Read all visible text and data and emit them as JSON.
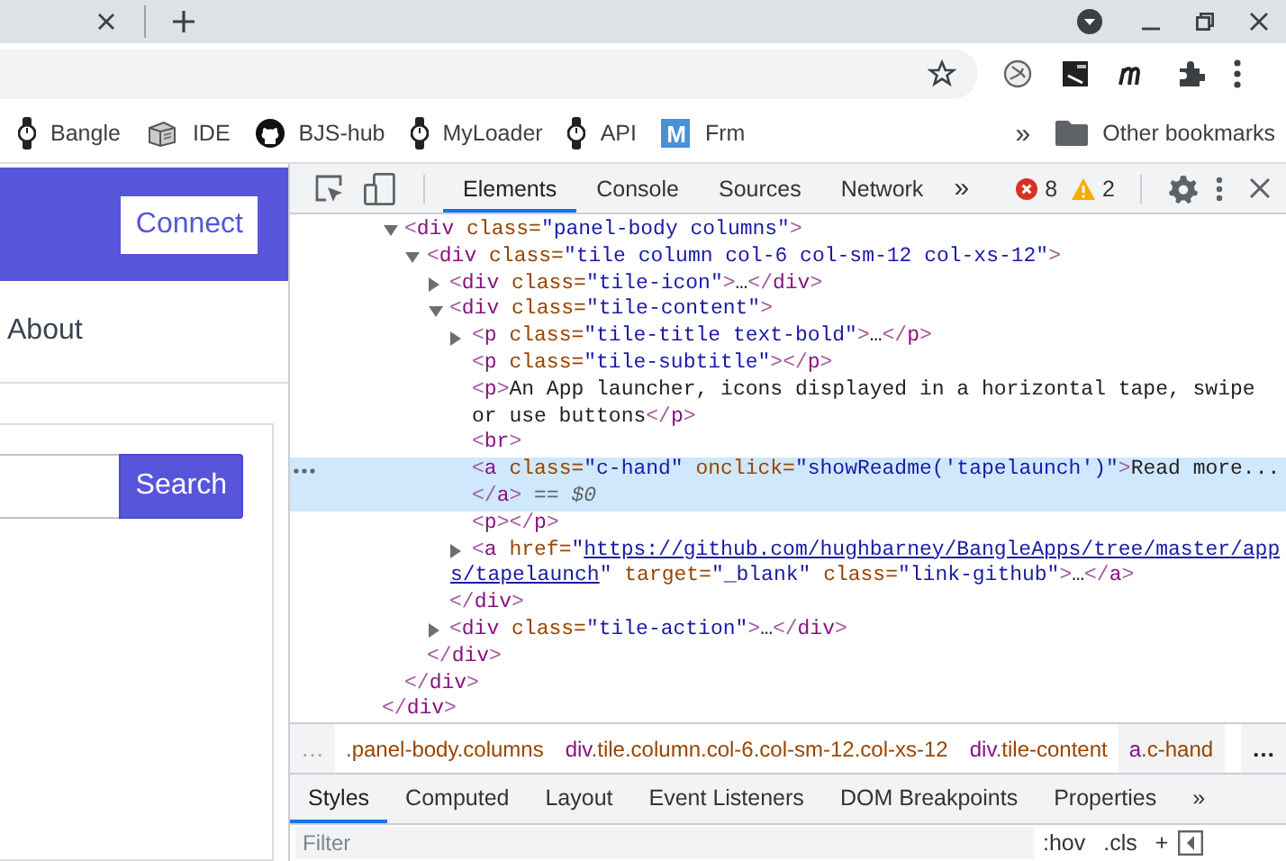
{
  "browser": {
    "bookmarks": [
      {
        "kind": "watch",
        "label": "Bangle"
      },
      {
        "kind": "ide",
        "label": "IDE"
      },
      {
        "kind": "github",
        "label": "BJS-hub"
      },
      {
        "kind": "watch",
        "label": "MyLoader"
      },
      {
        "kind": "watch",
        "label": "API"
      },
      {
        "kind": "letter",
        "badge": "M",
        "label": "Frm"
      }
    ],
    "bookmarks_more": "»",
    "other_bookmarks": "Other bookmarks"
  },
  "page": {
    "connect": "Connect",
    "nav": [
      "About"
    ],
    "search_button": "Search"
  },
  "devtools": {
    "tabs": [
      {
        "label": "Elements",
        "selected": true
      },
      {
        "label": "Console",
        "selected": false
      },
      {
        "label": "Sources",
        "selected": false
      },
      {
        "label": "Network",
        "selected": false
      }
    ],
    "tabs_more": "»",
    "errors": "8",
    "warnings": "2",
    "tree": [
      {
        "selected": false,
        "close": [
          {
            "kind": "bracket",
            "text": "</"
          },
          {
            "kind": "tag",
            "text": "div"
          },
          {
            "kind": "bracket",
            "text": ">"
          }
        ],
        "children": [
          {
            "selected": false,
            "expanded": true,
            "lines": [
              [
                {
                  "kind": "bracket",
                  "text": "<"
                },
                {
                  "kind": "tag",
                  "text": "div"
                },
                {
                  "kind": "attr",
                  "text": " class="
                },
                {
                  "kind": "value",
                  "text": "\"panel-body columns\""
                },
                {
                  "kind": "bracket",
                  "text": ">"
                }
              ]
            ],
            "close": [
              {
                "kind": "bracket",
                "text": "</"
              },
              {
                "kind": "tag",
                "text": "div"
              },
              {
                "kind": "bracket",
                "text": ">"
              }
            ],
            "children": [
              {
                "selected": false,
                "expanded": true,
                "lines": [
                  [
                    {
                      "kind": "bracket",
                      "text": "<"
                    },
                    {
                      "kind": "tag",
                      "text": "div"
                    },
                    {
                      "kind": "attr",
                      "text": " class="
                    },
                    {
                      "kind": "value",
                      "text": "\"tile column col-6 col-sm-12 col-xs-12\""
                    },
                    {
                      "kind": "bracket",
                      "text": ">"
                    }
                  ]
                ],
                "close": [
                  {
                    "kind": "bracket",
                    "text": "</"
                  },
                  {
                    "kind": "tag",
                    "text": "div"
                  },
                  {
                    "kind": "bracket",
                    "text": ">"
                  }
                ],
                "children": [
                  {
                    "selected": false,
                    "expanded": false,
                    "lines": [
                      [
                        {
                          "kind": "bracket",
                          "text": "<"
                        },
                        {
                          "kind": "tag",
                          "text": "div"
                        },
                        {
                          "kind": "attr",
                          "text": " class="
                        },
                        {
                          "kind": "value",
                          "text": "\"tile-icon\""
                        },
                        {
                          "kind": "bracket",
                          "text": ">"
                        },
                        {
                          "kind": "text",
                          "text": "…"
                        },
                        {
                          "kind": "bracket",
                          "text": "</"
                        },
                        {
                          "kind": "tag",
                          "text": "div"
                        },
                        {
                          "kind": "bracket",
                          "text": ">"
                        }
                      ]
                    ]
                  },
                  {
                    "selected": false,
                    "expanded": true,
                    "lines": [
                      [
                        {
                          "kind": "bracket",
                          "text": "<"
                        },
                        {
                          "kind": "tag",
                          "text": "div"
                        },
                        {
                          "kind": "attr",
                          "text": " class="
                        },
                        {
                          "kind": "value",
                          "text": "\"tile-content\""
                        },
                        {
                          "kind": "bracket",
                          "text": ">"
                        }
                      ]
                    ],
                    "close": [
                      {
                        "kind": "bracket",
                        "text": "</"
                      },
                      {
                        "kind": "tag",
                        "text": "div"
                      },
                      {
                        "kind": "bracket",
                        "text": ">"
                      }
                    ],
                    "children": [
                      {
                        "selected": false,
                        "expanded": false,
                        "lines": [
                          [
                            {
                              "kind": "bracket",
                              "text": "<"
                            },
                            {
                              "kind": "tag",
                              "text": "p"
                            },
                            {
                              "kind": "attr",
                              "text": " class="
                            },
                            {
                              "kind": "value",
                              "text": "\"tile-title text-bold\""
                            },
                            {
                              "kind": "bracket",
                              "text": ">"
                            },
                            {
                              "kind": "text",
                              "text": "…"
                            },
                            {
                              "kind": "bracket",
                              "text": "</"
                            },
                            {
                              "kind": "tag",
                              "text": "p"
                            },
                            {
                              "kind": "bracket",
                              "text": ">"
                            }
                          ]
                        ]
                      },
                      {
                        "selected": false,
                        "lines": [
                          [
                            {
                              "kind": "bracket",
                              "text": "<"
                            },
                            {
                              "kind": "tag",
                              "text": "p"
                            },
                            {
                              "kind": "attr",
                              "text": " class="
                            },
                            {
                              "kind": "value",
                              "text": "\"tile-subtitle\""
                            },
                            {
                              "kind": "bracket",
                              "text": ">"
                            },
                            {
                              "kind": "bracket",
                              "text": "</"
                            },
                            {
                              "kind": "tag",
                              "text": "p"
                            },
                            {
                              "kind": "bracket",
                              "text": ">"
                            }
                          ]
                        ]
                      },
                      {
                        "selected": false,
                        "lines": [
                          [
                            {
                              "kind": "bracket",
                              "text": "<"
                            },
                            {
                              "kind": "tag",
                              "text": "p"
                            },
                            {
                              "kind": "bracket",
                              "text": ">"
                            },
                            {
                              "kind": "text",
                              "text": "An App launcher, icons displayed in a horizontal tape, swipe"
                            }
                          ],
                          [
                            {
                              "kind": "text",
                              "text": "or use buttons"
                            },
                            {
                              "kind": "bracket",
                              "text": "</"
                            },
                            {
                              "kind": "tag",
                              "text": "p"
                            },
                            {
                              "kind": "bracket",
                              "text": ">"
                            }
                          ]
                        ]
                      },
                      {
                        "selected": false,
                        "lines": [
                          [
                            {
                              "kind": "bracket",
                              "text": "<"
                            },
                            {
                              "kind": "tag",
                              "text": "br"
                            },
                            {
                              "kind": "bracket",
                              "text": ">"
                            }
                          ]
                        ]
                      },
                      {
                        "selected": true,
                        "lines": [
                          [
                            {
                              "kind": "bracket",
                              "text": "<"
                            },
                            {
                              "kind": "tag",
                              "text": "a"
                            },
                            {
                              "kind": "attr",
                              "text": " class="
                            },
                            {
                              "kind": "value",
                              "text": "\"c-hand\""
                            },
                            {
                              "kind": "attr",
                              "text": " onclick="
                            },
                            {
                              "kind": "value",
                              "text": "\"showReadme('tapelaunch')\""
                            },
                            {
                              "kind": "bracket",
                              "text": ">"
                            },
                            {
                              "kind": "text",
                              "text": "Read more..."
                            }
                          ],
                          [
                            {
                              "kind": "bracket",
                              "text": "</"
                            },
                            {
                              "kind": "tag",
                              "text": "a"
                            },
                            {
                              "kind": "bracket",
                              "text": ">"
                            },
                            {
                              "kind": "note",
                              "text": " == $0"
                            }
                          ]
                        ]
                      },
                      {
                        "selected": false,
                        "lines": [
                          [
                            {
                              "kind": "bracket",
                              "text": "<"
                            },
                            {
                              "kind": "tag",
                              "text": "p"
                            },
                            {
                              "kind": "bracket",
                              "text": ">"
                            },
                            {
                              "kind": "bracket",
                              "text": "</"
                            },
                            {
                              "kind": "tag",
                              "text": "p"
                            },
                            {
                              "kind": "bracket",
                              "text": ">"
                            }
                          ]
                        ]
                      },
                      {
                        "selected": false,
                        "expanded": false,
                        "lines": [
                          [
                            {
                              "kind": "bracket",
                              "text": "<"
                            },
                            {
                              "kind": "tag",
                              "text": "a"
                            },
                            {
                              "kind": "attr",
                              "text": " href="
                            },
                            {
                              "kind": "value",
                              "text": "\""
                            },
                            {
                              "kind": "link",
                              "text": "https://github.com/hughbarney/BangleApps/tree/master/app"
                            }
                          ],
                          [
                            {
                              "kind": "link",
                              "text": "s/tapelaunch"
                            },
                            {
                              "kind": "value",
                              "text": "\""
                            },
                            {
                              "kind": "attr",
                              "text": " target="
                            },
                            {
                              "kind": "value",
                              "text": "\"_blank\""
                            },
                            {
                              "kind": "attr",
                              "text": " class="
                            },
                            {
                              "kind": "value",
                              "text": "\"link-github\""
                            },
                            {
                              "kind": "bracket",
                              "text": ">"
                            },
                            {
                              "kind": "text",
                              "text": "…"
                            },
                            {
                              "kind": "bracket",
                              "text": "</"
                            },
                            {
                              "kind": "tag",
                              "text": "a"
                            },
                            {
                              "kind": "bracket",
                              "text": ">"
                            }
                          ]
                        ]
                      }
                    ]
                  },
                  {
                    "selected": false,
                    "expanded": false,
                    "lines": [
                      [
                        {
                          "kind": "bracket",
                          "text": "<"
                        },
                        {
                          "kind": "tag",
                          "text": "div"
                        },
                        {
                          "kind": "attr",
                          "text": " class="
                        },
                        {
                          "kind": "value",
                          "text": "\"tile-action\""
                        },
                        {
                          "kind": "bracket",
                          "text": ">"
                        },
                        {
                          "kind": "text",
                          "text": "…"
                        },
                        {
                          "kind": "bracket",
                          "text": "</"
                        },
                        {
                          "kind": "tag",
                          "text": "div"
                        },
                        {
                          "kind": "bracket",
                          "text": ">"
                        }
                      ]
                    ]
                  }
                ]
              }
            ]
          }
        ]
      }
    ],
    "breadcrumbs_scroll_left": "…",
    "breadcrumbs": [
      {
        "classes": ".panel-body.columns",
        "selected": false
      },
      {
        "tag": "div",
        "classes": ".tile.column.col-6.col-sm-12.col-xs-12",
        "selected": false
      },
      {
        "tag": "div",
        "classes": ".tile-content",
        "selected": false
      },
      {
        "tag": "a",
        "classes": ".c-hand",
        "selected": true
      }
    ],
    "breadcrumbs_scroll_right": "…",
    "panes": [
      {
        "label": "Styles",
        "selected": true
      },
      {
        "label": "Computed",
        "selected": false
      },
      {
        "label": "Layout",
        "selected": false
      },
      {
        "label": "Event Listeners",
        "selected": false
      },
      {
        "label": "DOM Breakpoints",
        "selected": false
      },
      {
        "label": "Properties",
        "selected": false
      }
    ],
    "panes_more": "»",
    "filter": {
      "placeholder": "Filter"
    },
    "filter_buttons": [
      ":hov",
      ".cls",
      "+"
    ]
  }
}
